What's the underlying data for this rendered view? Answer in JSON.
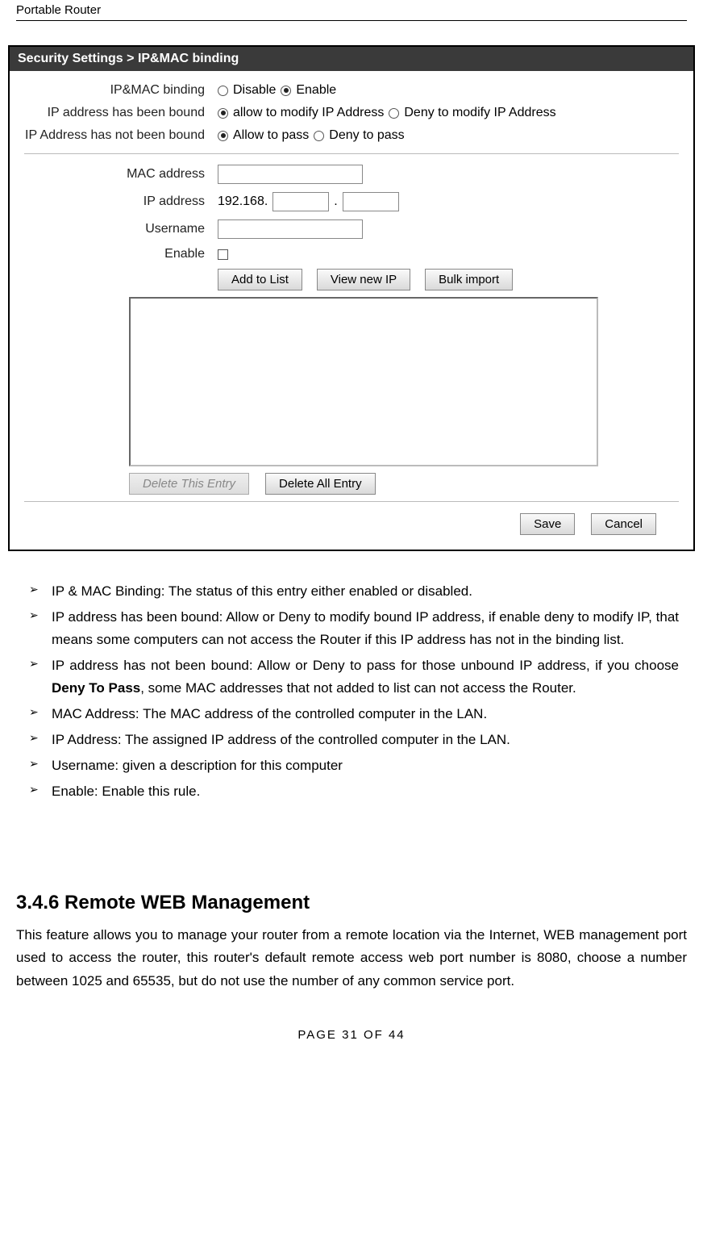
{
  "header": {
    "title": "Portable Router"
  },
  "breadcrumb": "Security Settings > IP&MAC binding",
  "form": {
    "rows": [
      {
        "label": "IP&MAC binding",
        "opts": [
          "Disable",
          "Enable"
        ],
        "selected": 1
      },
      {
        "label": "IP address has been bound",
        "opts": [
          "allow to modify IP Address",
          "Deny to modify IP Address"
        ],
        "selected": 0
      },
      {
        "label": "IP Address has not been bound",
        "opts": [
          "Allow to pass",
          "Deny to pass"
        ],
        "selected": 0
      }
    ],
    "mac_label": "MAC address",
    "ip_label": "IP address",
    "ip_prefix": "192.168.",
    "user_label": "Username",
    "enable_label": "Enable"
  },
  "buttons": {
    "add": "Add to List",
    "view": "View new IP",
    "bulk": "Bulk import",
    "del_this": "Delete This Entry",
    "del_all": "Delete All Entry",
    "save": "Save",
    "cancel": "Cancel"
  },
  "bullets": [
    "IP & MAC Binding: The status of this entry either enabled or disabled.",
    "IP address has been bound: Allow or Deny to modify bound IP address, if enable deny to modify IP, that means some computers can not access the Router if this IP address has not in the binding list.",
    "IP address has not been bound: Allow or Deny to pass for those unbound IP address, if you choose Deny To Pass, some MAC addresses that not added to list can not access the Router.",
    "MAC Address: The MAC address of the controlled computer in the LAN.",
    "IP Address: The assigned IP address of the controlled computer in the LAN.",
    "Username: given a description for this computer",
    "Enable: Enable this rule."
  ],
  "bold_phrase": "Deny To Pass",
  "section": {
    "heading": "3.4.6 Remote WEB Management",
    "para": "This feature allows you to manage your router from a remote location via the Internet, WEB management port used to access the router, this router's default remote access web port number is 8080, choose a number between 1025 and 65535, but do not use the number of any common service port."
  },
  "footer": "PAGE    31    OF    44"
}
